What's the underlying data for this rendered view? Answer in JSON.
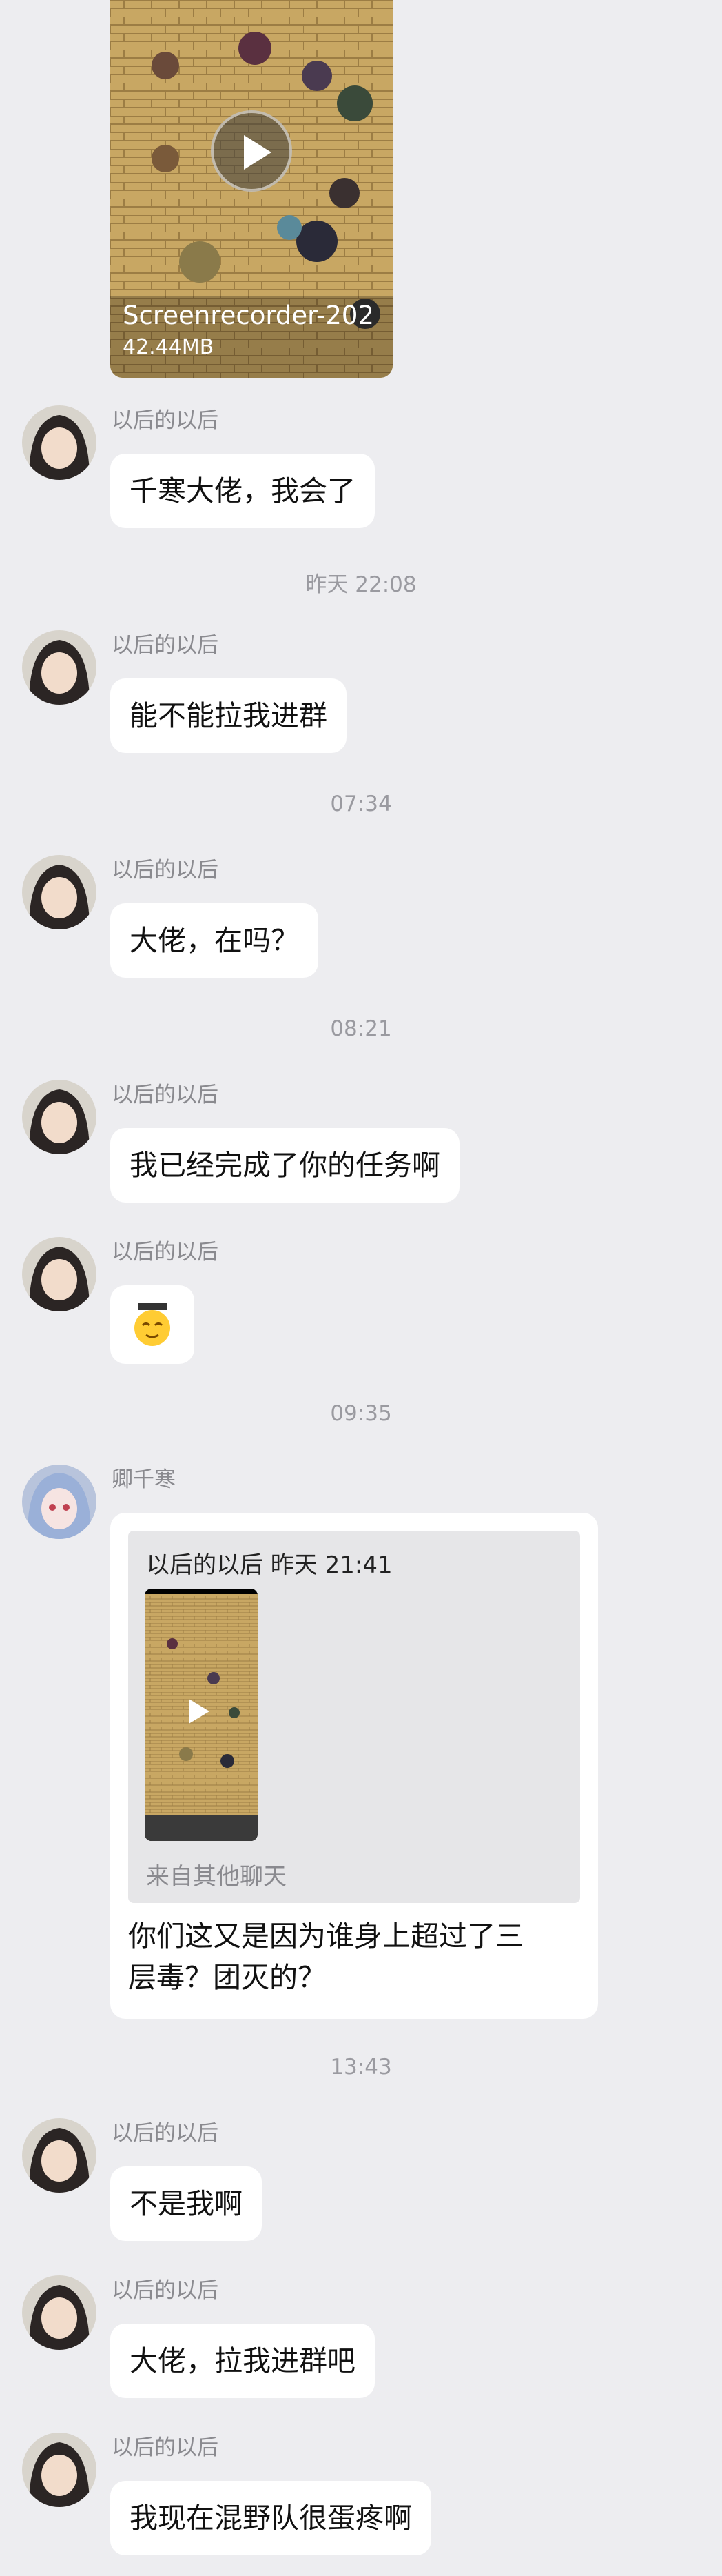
{
  "video_top": {
    "filename": "Screenrecorder-202",
    "size": "42.44MB"
  },
  "messages": [
    {
      "sender": "以后的以后",
      "text": "千寒大佬，我会了"
    },
    {
      "time": "昨天 22:08"
    },
    {
      "sender": "以后的以后",
      "text": "能不能拉我进群"
    },
    {
      "time": "07:34"
    },
    {
      "sender": "以后的以后",
      "text": "大佬，在吗？"
    },
    {
      "time": "08:21"
    },
    {
      "sender": "以后的以后",
      "text": "我已经完成了你的任务啊"
    },
    {
      "sender": "以后的以后",
      "sticker": "emoji-face"
    },
    {
      "time": "09:35"
    }
  ],
  "forward": {
    "sender": "卿千寒",
    "quote_header": "以后的以后 昨天 21:41",
    "quote_footer": "来自其他聊天",
    "text_line1": "你们这又是因为谁身上超过了三",
    "text_line2": "层毒？团灭的？"
  },
  "messages2": [
    {
      "time": "13:43"
    },
    {
      "sender": "以后的以后",
      "text": "不是我啊"
    },
    {
      "sender": "以后的以后",
      "text": "大佬，拉我进群吧"
    },
    {
      "sender": "以后的以后",
      "text": "我现在混野队很蛋疼啊"
    }
  ],
  "colors": {
    "background": "#ededf0",
    "bubble": "#ffffff",
    "quote_bg": "#e6e6e8"
  }
}
